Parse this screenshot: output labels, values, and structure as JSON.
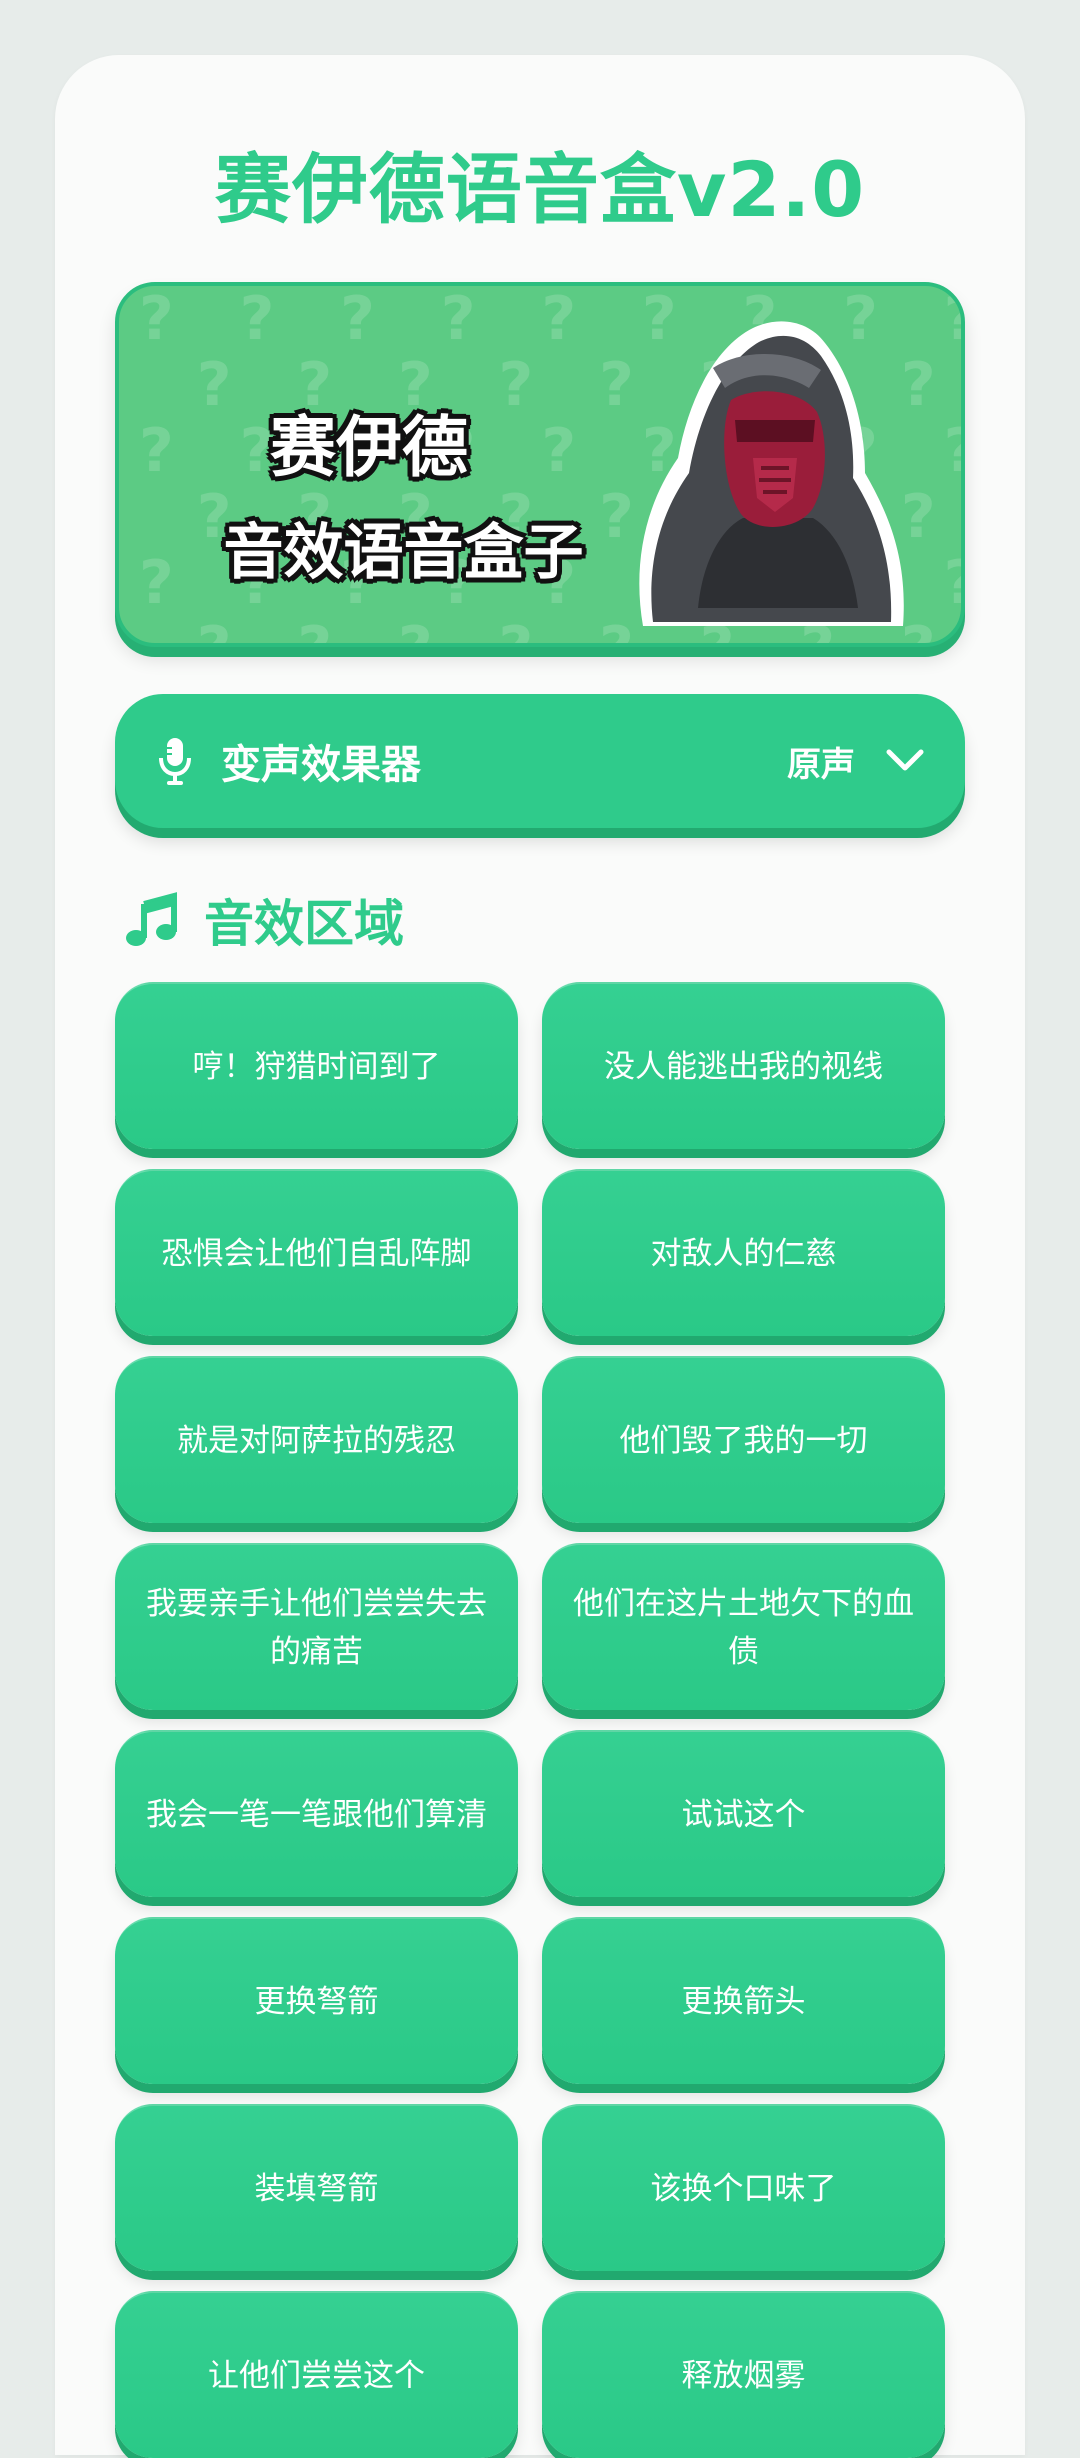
{
  "app": {
    "title": "赛伊德语音盒v2.0"
  },
  "banner": {
    "line1": "赛伊德",
    "line2": "音效语音盒子",
    "pattern_glyph": "?"
  },
  "voice_changer": {
    "title": "变声效果器",
    "selected": "原声",
    "icon": "microphone-icon",
    "dropdown_icon": "chevron-down-icon"
  },
  "sounds": {
    "title": "音效区域",
    "icon": "music-note-icon",
    "items": [
      {
        "label": "哼！狩猎时间到了"
      },
      {
        "label": "没人能逃出我的视线"
      },
      {
        "label": "恐惧会让他们自乱阵脚"
      },
      {
        "label": "对敌人的仁慈"
      },
      {
        "label": "就是对阿萨拉的残忍"
      },
      {
        "label": "他们毁了我的一切"
      },
      {
        "label": "我要亲手让他们尝尝失去的痛苦"
      },
      {
        "label": "他们在这片土地欠下的血债"
      },
      {
        "label": "我会一笔一笔跟他们算清"
      },
      {
        "label": "试试这个"
      },
      {
        "label": "更换弩箭"
      },
      {
        "label": "更换箭头"
      },
      {
        "label": "装填弩箭"
      },
      {
        "label": "该换个口味了"
      },
      {
        "label": "让他们尝尝这个"
      },
      {
        "label": "释放烟雾"
      }
    ]
  },
  "colors": {
    "accent": "#2fcb8b",
    "accent_dark": "#22aa70",
    "banner_bg": "#5ccb84",
    "page_bg": "#e7ecea",
    "card_bg": "#fafbfa"
  }
}
